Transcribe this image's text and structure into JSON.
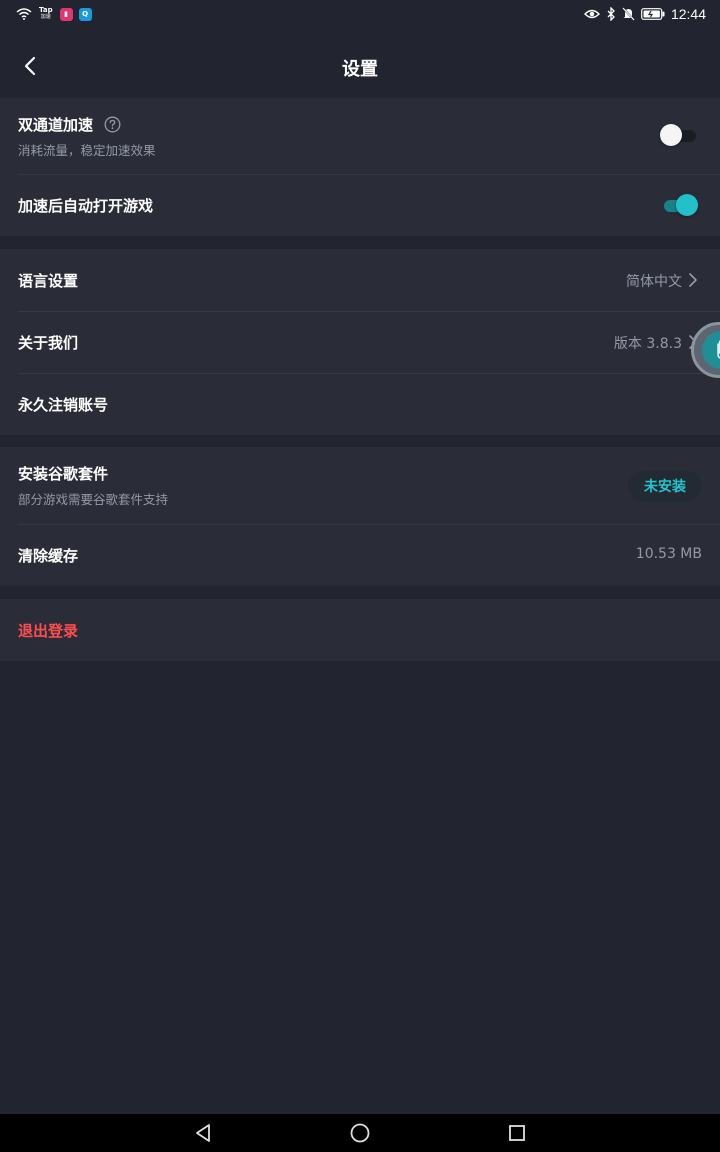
{
  "status_bar": {
    "tap_badge_top": "Tap",
    "tap_badge_bottom": "加速",
    "time": "12:44"
  },
  "header": {
    "title": "设置"
  },
  "sections": {
    "dual_channel": {
      "title": "双通道加速",
      "subtitle": "消耗流量，稳定加速效果",
      "enabled": false
    },
    "auto_open": {
      "title": "加速后自动打开游戏",
      "enabled": true
    },
    "language": {
      "title": "语言设置",
      "value": "简体中文"
    },
    "about": {
      "title": "关于我们",
      "value": "版本 3.8.3"
    },
    "delete_account": {
      "title": "永久注销账号"
    },
    "google_suite": {
      "title": "安装谷歌套件",
      "subtitle": "部分游戏需要谷歌套件支持",
      "button_label": "未安装"
    },
    "clear_cache": {
      "title": "清除缓存",
      "value": "10.53 MB"
    },
    "logout": {
      "label": "退出登录"
    }
  },
  "colors": {
    "accent": "#22c1c9",
    "danger": "#ff4d4f",
    "background": "#22252f",
    "card": "#2a2d38"
  }
}
